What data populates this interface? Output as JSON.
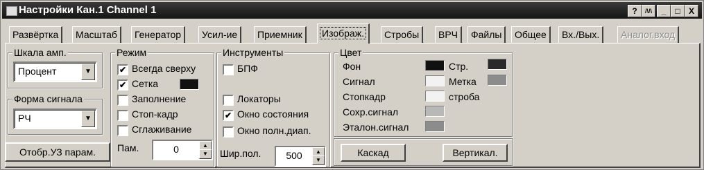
{
  "window": {
    "title": "Настройки Кан.1 Channel 1",
    "buttons": [
      "?",
      "/\\/\\",
      "_",
      "□",
      "X"
    ]
  },
  "tabs": [
    "Развёртка",
    "Масштаб",
    "Генератор",
    "Усил-ие",
    "Приемник",
    "Изображ.",
    "Стробы",
    "ВРЧ",
    "Файлы",
    "Общее",
    "Вх./Вых.",
    "Аналог.вход"
  ],
  "amp_scale": {
    "caption": "Шкала амп.",
    "value": "Процент"
  },
  "signal_form": {
    "caption": "Форма сигнала",
    "value": "РЧ"
  },
  "us_params_button": "Отобр.УЗ парам.",
  "mode": {
    "caption": "Режим",
    "always_on_top": "Всегда сверху",
    "grid": "Сетка",
    "fill": "Заполнение",
    "freeze": "Стоп-кадр",
    "smoothing": "Сглаживание",
    "memory_label": "Пам.",
    "memory_value": "0",
    "grid_color": "#111111"
  },
  "tools": {
    "caption": "Инструменты",
    "fft": "БПФ",
    "locators": "Локаторы",
    "status_window": "Окно состояния",
    "full_range_window": "Окно полн.диап.",
    "width_label": "Шир.пол.",
    "width_value": "500"
  },
  "color": {
    "caption": "Цвет",
    "background": "Фон",
    "signal": "Сигнал",
    "freeze_frame": "Стопкадр",
    "saved_signal": "Сохр.сигнал",
    "reference_signal": "Эталон.сигнал",
    "str": "Стр.",
    "mark": "Метка",
    "gate": "строба",
    "bg_color": "#111111",
    "signal_color": "#f2f2f2",
    "freeze_color": "#f2f2f2",
    "saved_color": "#b8b8b8",
    "reference_color": "#8c8c8c",
    "str_color": "#2a2a2a",
    "mark_color": "#8c8c8c",
    "gate_color": "#f2f2f2"
  },
  "layout_buttons": {
    "cascade": "Каскад",
    "vertical": "Вертикал."
  }
}
